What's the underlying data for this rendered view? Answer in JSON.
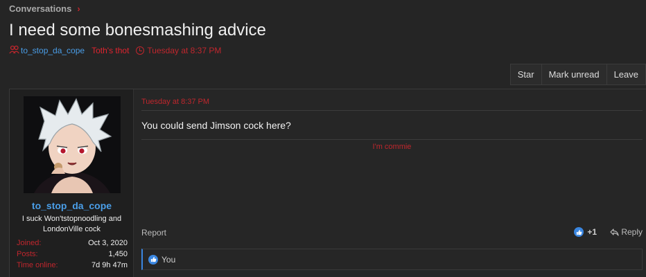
{
  "breadcrumb": {
    "label": "Conversations"
  },
  "page": {
    "title": "I need some bonesmashing advice"
  },
  "meta": {
    "participant_1": "to_stop_da_cope",
    "participant_2": "Toth's thot",
    "date": "Tuesday at 8:37 PM"
  },
  "actions": {
    "star": "Star",
    "mark_unread": "Mark unread",
    "leave": "Leave"
  },
  "post": {
    "author": "to_stop_da_cope",
    "user_title": "I suck Won'tstopnoodling and LondonVille cock",
    "stats": [
      {
        "label": "Joined:",
        "value": "Oct 3, 2020"
      },
      {
        "label": "Posts:",
        "value": "1,450"
      },
      {
        "label": "Time online:",
        "value": "7d 9h 47m"
      }
    ],
    "date": "Tuesday at 8:37 PM",
    "body": "You could send Jimson cock here?",
    "signature": "I'm commie",
    "report": "Report",
    "reaction_count": "+1",
    "reply": "Reply",
    "reactions_by": "You"
  },
  "colors": {
    "accent_red": "#c0262d",
    "link_blue": "#4a9ee8",
    "like_blue": "#3a86e0"
  }
}
